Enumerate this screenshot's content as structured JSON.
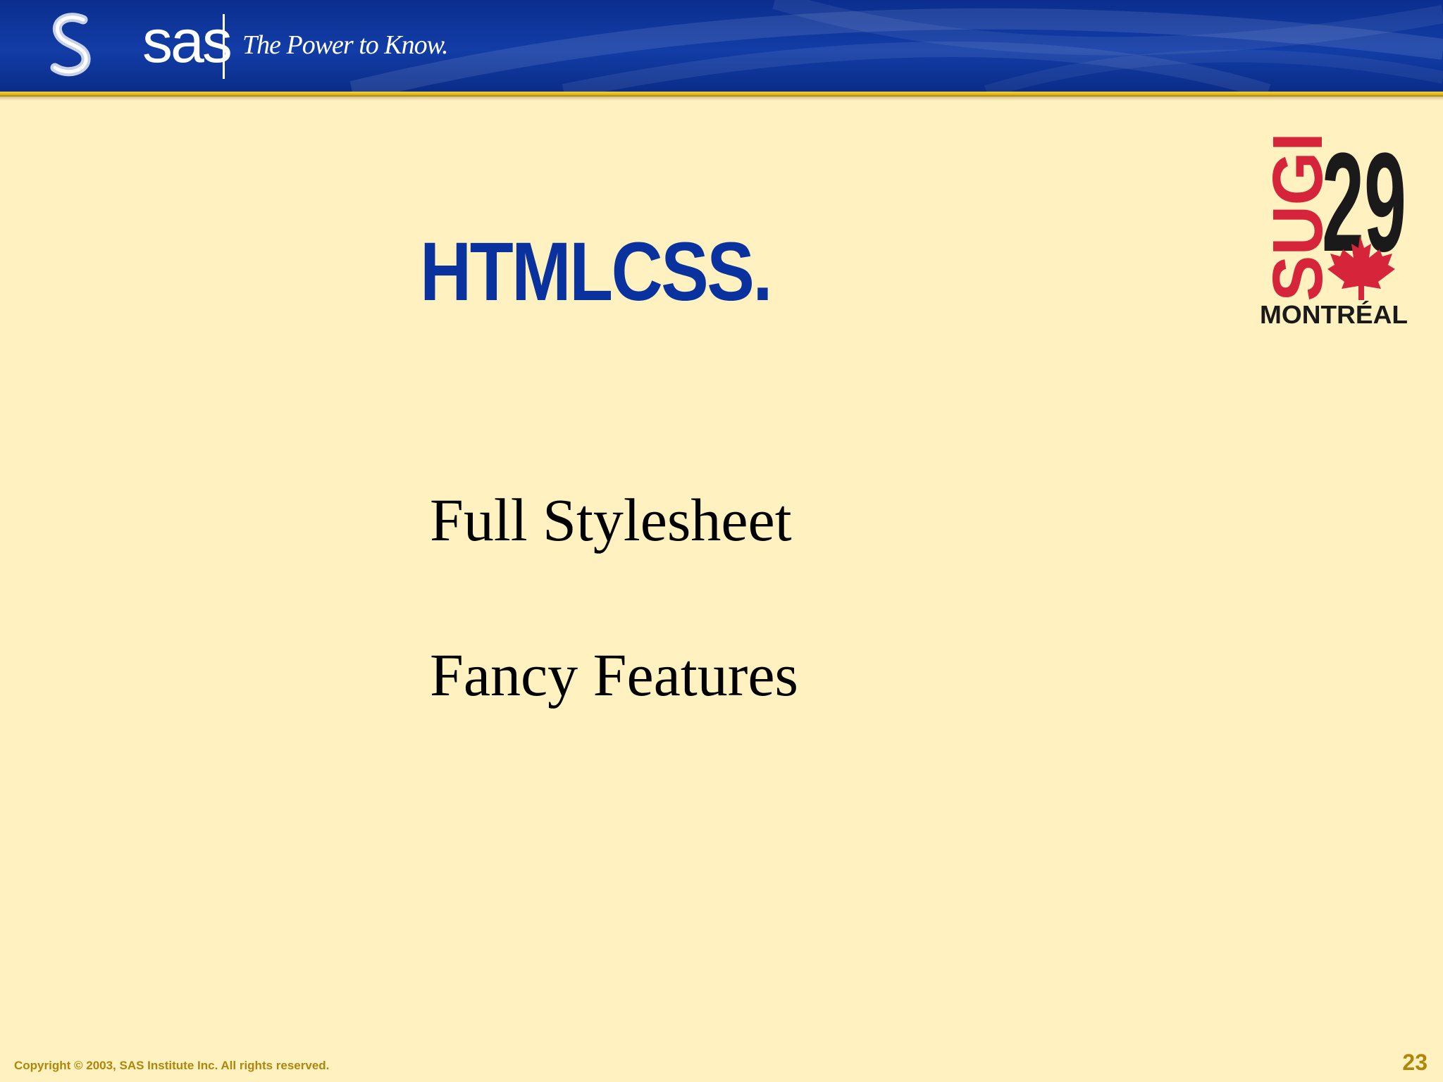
{
  "header": {
    "brand_logo_text": "sas",
    "tagline": "The Power to Know."
  },
  "conference_logo": {
    "event": "SUGI",
    "number": "29",
    "city": "MONTRÉAL",
    "icon": "maple-leaf-icon"
  },
  "slide": {
    "title": "HTMLCSS.",
    "bullets": [
      "Full Stylesheet",
      "Fancy Features"
    ]
  },
  "footer": {
    "copyright": "Copyright © 2003, SAS Institute Inc. All rights reserved.",
    "page_number": "23"
  },
  "colors": {
    "background": "#FFF2C0",
    "header_blue": "#0B2E8F",
    "title_blue": "#0A329F",
    "accent_gold": "#E0B514",
    "footer_text": "#B0860A",
    "logo_red": "#D6243A"
  }
}
